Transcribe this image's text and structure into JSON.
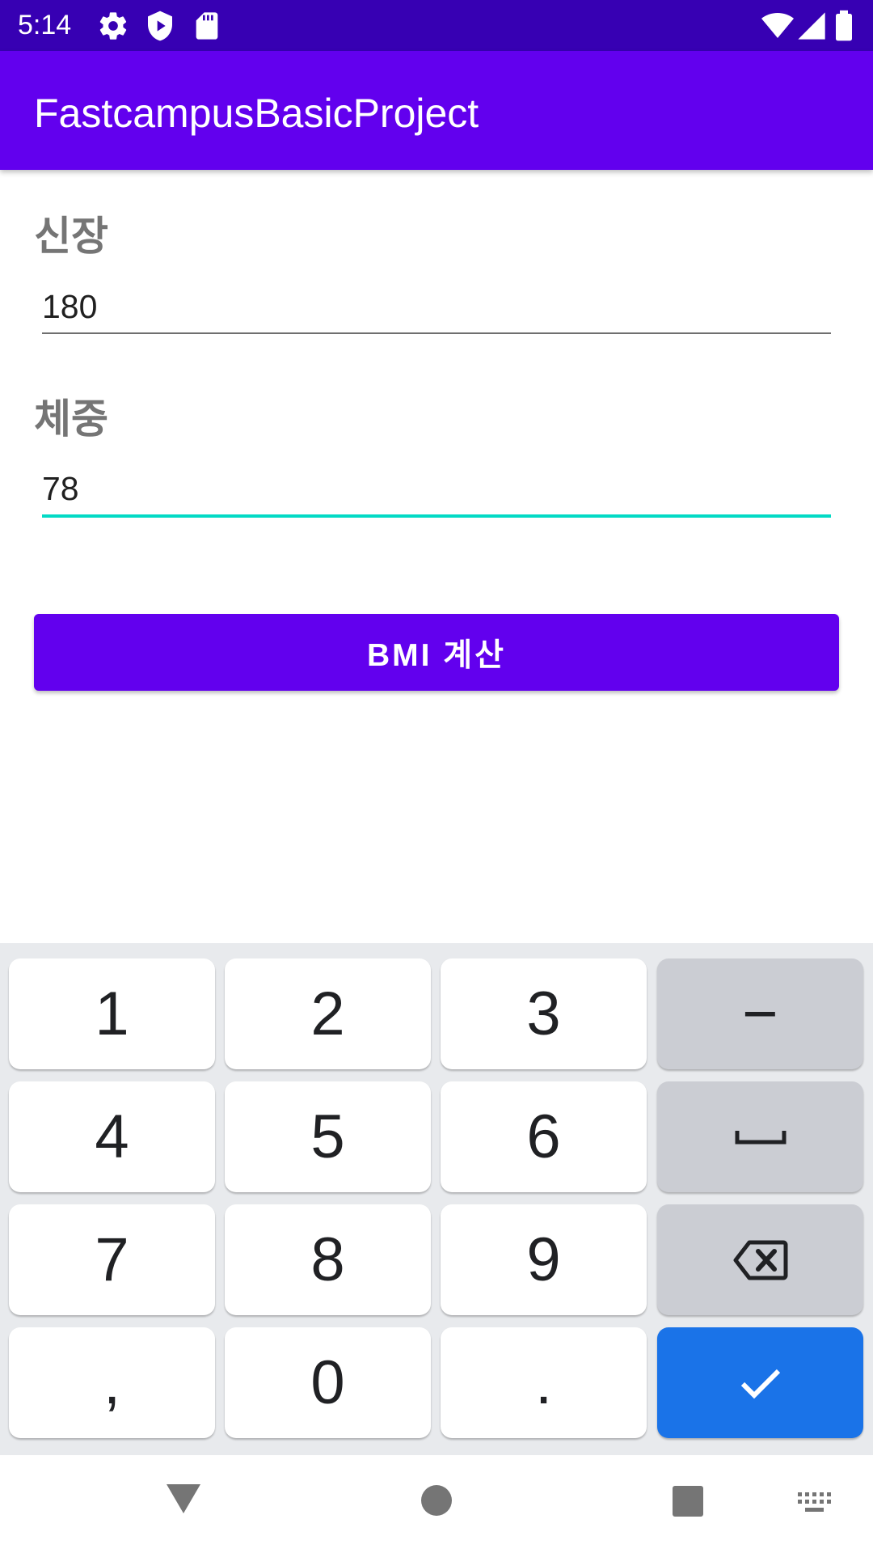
{
  "status_bar": {
    "time": "5:14",
    "left_icons": [
      "gear-icon",
      "shield-icon",
      "sd-card-icon"
    ],
    "right_icons": [
      "wifi-icon",
      "signal-icon",
      "battery-icon"
    ],
    "background": "#3700b3"
  },
  "app_bar": {
    "title": "FastcampusBasicProject",
    "background": "#6200ee"
  },
  "form": {
    "height_label": "신장",
    "height_value": "180",
    "weight_label": "체중",
    "weight_value": "78",
    "focused_line_color": "#03dac5",
    "button_label": "BMI 계산",
    "button_color": "#6200ee"
  },
  "keyboard": {
    "rows": [
      [
        "1",
        "2",
        "3",
        "−"
      ],
      [
        "4",
        "5",
        "6",
        "space-icon"
      ],
      [
        "7",
        "8",
        "9",
        "backspace-icon"
      ],
      [
        ",",
        "0",
        ".",
        "check-icon"
      ]
    ],
    "labels": {
      "k1": "1",
      "k2": "2",
      "k3": "3",
      "kminus": "−",
      "k4": "4",
      "k5": "5",
      "k6": "6",
      "k7": "7",
      "k8": "8",
      "k9": "9",
      "kcomma": ",",
      "k0": "0",
      "kdot": "."
    },
    "action_color": "#1a73e8"
  },
  "nav_bar": {
    "icons": [
      "back-icon",
      "home-icon",
      "recents-icon",
      "keyboard-icon"
    ]
  }
}
